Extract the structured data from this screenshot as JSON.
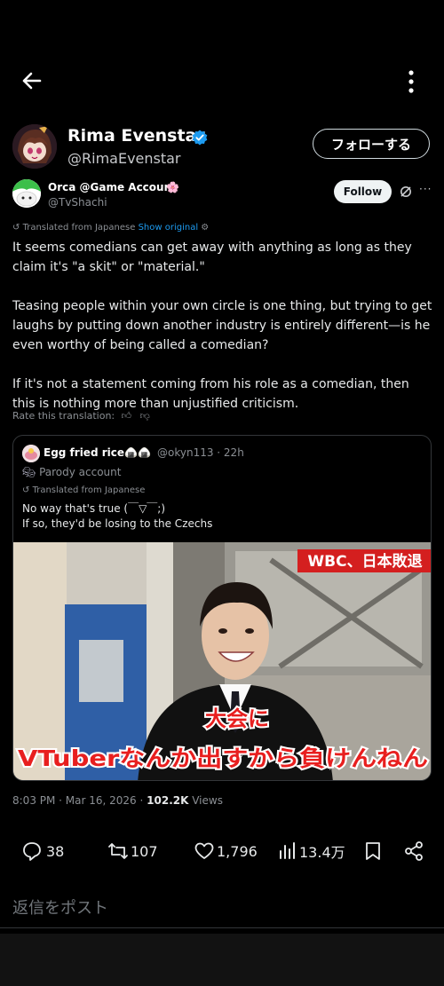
{
  "header": {
    "back_icon": "arrow-left-icon",
    "more_icon": "more-vertical-icon"
  },
  "author": {
    "name": "Rima Evenstar",
    "handle": "@RimaEvenstar",
    "follow_label": "フォローする"
  },
  "embedded_author": {
    "name": "Orca @Game Account",
    "flower": "🌸",
    "handle": "@TvShachi",
    "follow_label": "Follow",
    "more": "···"
  },
  "translation": {
    "label": "Translated from Japanese",
    "show_original": "Show original"
  },
  "post": {
    "paragraphs": [
      "It seems comedians can get away with anything as long as they claim it's \"a skit\" or \"material.\"",
      "Teasing people within your own circle is one thing, but trying to get laughs by putting down another industry is entirely different—is he even worthy of being called a comedian?",
      "If it's not a statement coming from his role as a comedian, then this is nothing more than unjustified criticism."
    ],
    "rate_label": "Rate this translation:"
  },
  "quote": {
    "name": "Egg fried rice🍙🍙",
    "handle_time": "@okyn113 · 22h",
    "parody": "Parody account",
    "translated": "Translated from Japanese",
    "line1": "No way that's true (￣▽￣;)",
    "line2": "If so, they'd be losing to the Czechs",
    "image": {
      "banner": "WBC、日本敗退",
      "caption1": "大会に",
      "caption2": "VTuberなんか出すから負けんねん"
    }
  },
  "meta": {
    "time": "8:03 PM · Mar 16, 2026 · ",
    "views_count": "102.2K",
    "views_label": " Views"
  },
  "actions": {
    "replies": "38",
    "reposts": "107",
    "likes": "1,796",
    "views": "13.4万"
  },
  "reply_placeholder": "返信をポスト",
  "colors": {
    "accent": "#1d9bf0",
    "banner_red": "#d41f1f"
  }
}
